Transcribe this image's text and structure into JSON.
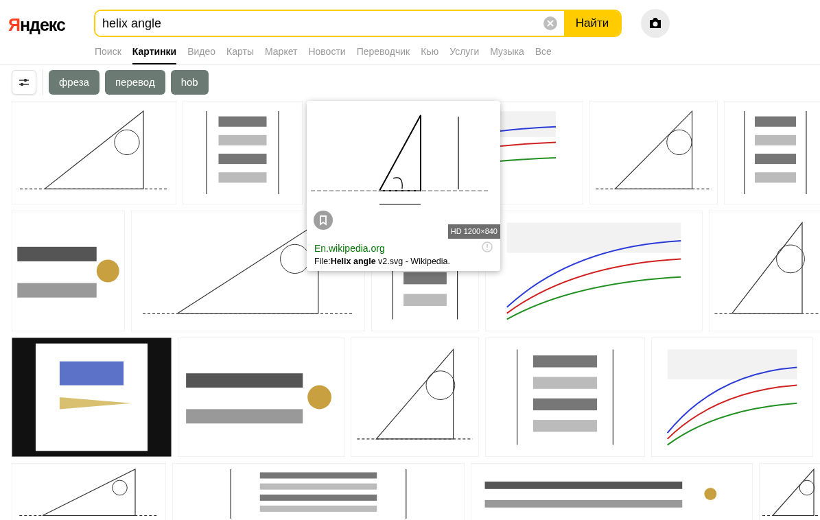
{
  "logo": "Яндекс",
  "search": {
    "value": "helix angle",
    "button": "Найти"
  },
  "tabs": [
    {
      "label": "Поиск",
      "selected": false
    },
    {
      "label": "Картинки",
      "selected": true
    },
    {
      "label": "Видео",
      "selected": false
    },
    {
      "label": "Карты",
      "selected": false
    },
    {
      "label": "Маркет",
      "selected": false
    },
    {
      "label": "Новости",
      "selected": false
    },
    {
      "label": "Переводчик",
      "selected": false
    },
    {
      "label": "Кью",
      "selected": false
    },
    {
      "label": "Услуги",
      "selected": false
    },
    {
      "label": "Музыка",
      "selected": false
    },
    {
      "label": "Все",
      "selected": false
    }
  ],
  "chips": [
    "фреза",
    "перевод",
    "hob"
  ],
  "results": [
    [
      {
        "kind": "picture"
      },
      {
        "kind": "picture"
      },
      {
        "kind": "picture"
      },
      {
        "kind": "picture"
      },
      {
        "kind": "picture"
      }
    ],
    [
      {
        "kind": "picture"
      },
      {
        "kind": "picture"
      },
      {
        "kind": "picture"
      },
      {
        "kind": "picture"
      },
      {
        "kind": "picture"
      }
    ],
    [
      {
        "kind": "picture"
      },
      {
        "kind": "picture"
      },
      {
        "kind": "picture"
      },
      {
        "kind": "picture"
      },
      {
        "kind": "picture"
      }
    ],
    [
      {
        "kind": "picture"
      },
      {
        "kind": "picture"
      },
      {
        "kind": "picture"
      },
      {
        "kind": "picture"
      }
    ]
  ],
  "preview": {
    "badge": "HD 1200×840",
    "source": "En.wikipedia.org",
    "caption": "File:**Helix angle** v2.svg - Wikipedia."
  }
}
